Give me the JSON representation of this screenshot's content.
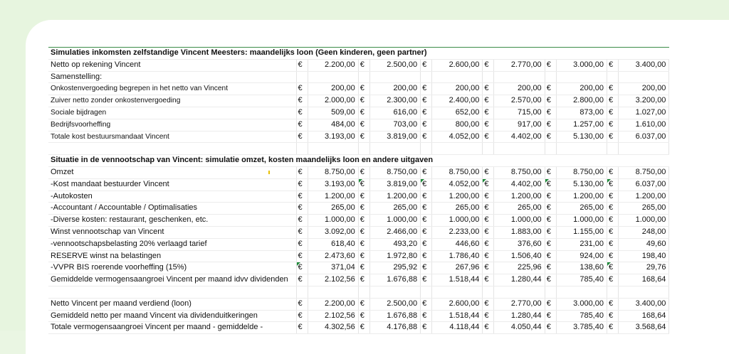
{
  "section1": {
    "title": "Simulaties inkomsten zelfstandige Vincent Meesters: maandelijks loon (Geen kinderen, geen partner)",
    "rows": [
      {
        "label": "Netto op rekening Vincent",
        "small": false,
        "values": [
          "2.200,00",
          "2.500,00",
          "2.600,00",
          "2.770,00",
          "3.000,00",
          "3.400,00"
        ],
        "markers": []
      },
      {
        "label": "Samenstelling:",
        "small": false,
        "values": [],
        "markers": []
      },
      {
        "label": "Onkostenvergoeding begrepen in het netto van Vincent",
        "small": true,
        "values": [
          "200,00",
          "200,00",
          "200,00",
          "200,00",
          "200,00",
          "200,00"
        ],
        "markers": []
      },
      {
        "label": "Zuiver netto zonder onkostenvergoeding",
        "small": true,
        "values": [
          "2.000,00",
          "2.300,00",
          "2.400,00",
          "2.570,00",
          "2.800,00",
          "3.200,00"
        ],
        "markers": []
      },
      {
        "label": "Sociale bijdragen",
        "small": true,
        "values": [
          "509,00",
          "616,00",
          "652,00",
          "715,00",
          "873,00",
          "1.027,00"
        ],
        "markers": []
      },
      {
        "label": "Bedrijfsvoorheffing",
        "small": true,
        "values": [
          "484,00",
          "703,00",
          "800,00",
          "917,00",
          "1.257,00",
          "1.610,00"
        ],
        "markers": []
      },
      {
        "label": "Totale kost bestuursmandaat Vincent",
        "small": true,
        "values": [
          "3.193,00",
          "3.819,00",
          "4.052,00",
          "4.402,00",
          "5.130,00",
          "6.037,00"
        ],
        "markers": []
      }
    ]
  },
  "section2": {
    "title": "Situatie in de vennootschap van Vincent: simulatie omzet, kosten maandelijks loon en andere uitgaven",
    "rows": [
      {
        "label": "Omzet",
        "small": false,
        "values": [
          "8.750,00",
          "8.750,00",
          "8.750,00",
          "8.750,00",
          "8.750,00",
          "8.750,00"
        ],
        "markers": []
      },
      {
        "label": "-Kost mandaat bestuurder Vincent",
        "small": false,
        "values": [
          "3.193,00",
          "3.819,00",
          "4.052,00",
          "4.402,00",
          "5.130,00",
          "6.037,00"
        ],
        "markers": [
          1,
          2,
          3,
          4,
          5
        ]
      },
      {
        "label": "-Autokosten",
        "small": false,
        "values": [
          "1.200,00",
          "1.200,00",
          "1.200,00",
          "1.200,00",
          "1.200,00",
          "1.200,00"
        ],
        "markers": []
      },
      {
        "label": "-Accountant / Accountable / Optimalisaties",
        "small": false,
        "values": [
          "265,00",
          "265,00",
          "265,00",
          "265,00",
          "265,00",
          "265,00"
        ],
        "markers": []
      },
      {
        "label": "-Diverse kosten: restaurant, geschenken, etc.",
        "small": false,
        "values": [
          "1.000,00",
          "1.000,00",
          "1.000,00",
          "1.000,00",
          "1.000,00",
          "1.000,00"
        ],
        "markers": []
      },
      {
        "label": "Winst vennootschap van Vincent",
        "small": false,
        "values": [
          "3.092,00",
          "2.466,00",
          "2.233,00",
          "1.883,00",
          "1.155,00",
          "248,00"
        ],
        "markers": []
      },
      {
        "label": "-vennootschapsbelasting 20% verlaagd tarief",
        "small": false,
        "values": [
          "618,40",
          "493,20",
          "446,60",
          "376,60",
          "231,00",
          "49,60"
        ],
        "markers": []
      },
      {
        "label": "RESERVE winst na belastingen",
        "small": false,
        "values": [
          "2.473,60",
          "1.972,80",
          "1.786,40",
          "1.506,40",
          "924,00",
          "198,40"
        ],
        "markers": []
      },
      {
        "label": "-VVPR BIS roerende voorheffing (15%)",
        "small": false,
        "values": [
          "371,04",
          "295,92",
          "267,96",
          "225,96",
          "138,60",
          "29,76"
        ],
        "markers": [
          0,
          5
        ]
      },
      {
        "label": "Gemiddelde vermogensaangroei Vincent per maand idvv dividenden",
        "small": false,
        "values": [
          "2.102,56",
          "1.676,88",
          "1.518,44",
          "1.280,44",
          "785,40",
          "168,64"
        ],
        "markers": []
      }
    ]
  },
  "section3": {
    "rows": [
      {
        "label": "Netto Vincent per maand verdiend (loon)",
        "small": false,
        "values": [
          "2.200,00",
          "2.500,00",
          "2.600,00",
          "2.770,00",
          "3.000,00",
          "3.400,00"
        ],
        "markers": []
      },
      {
        "label": "Gemiddeld netto per maand Vincent via dividenduitkeringen",
        "small": false,
        "values": [
          "2.102,56",
          "1.676,88",
          "1.518,44",
          "1.280,44",
          "785,40",
          "168,64"
        ],
        "markers": []
      },
      {
        "label": "Totale vermogensaangroei Vincent per maand - gemiddelde -",
        "small": false,
        "values": [
          "4.302,56",
          "4.176,88",
          "4.118,44",
          "4.050,44",
          "3.785,40",
          "3.568,64"
        ],
        "markers": []
      }
    ]
  },
  "currency_symbol": "€",
  "colors": {
    "background": "#e7f5df",
    "card": "#ffffff",
    "accent_border": "#3a8c47",
    "comment_marker": "#1e8a3a"
  }
}
